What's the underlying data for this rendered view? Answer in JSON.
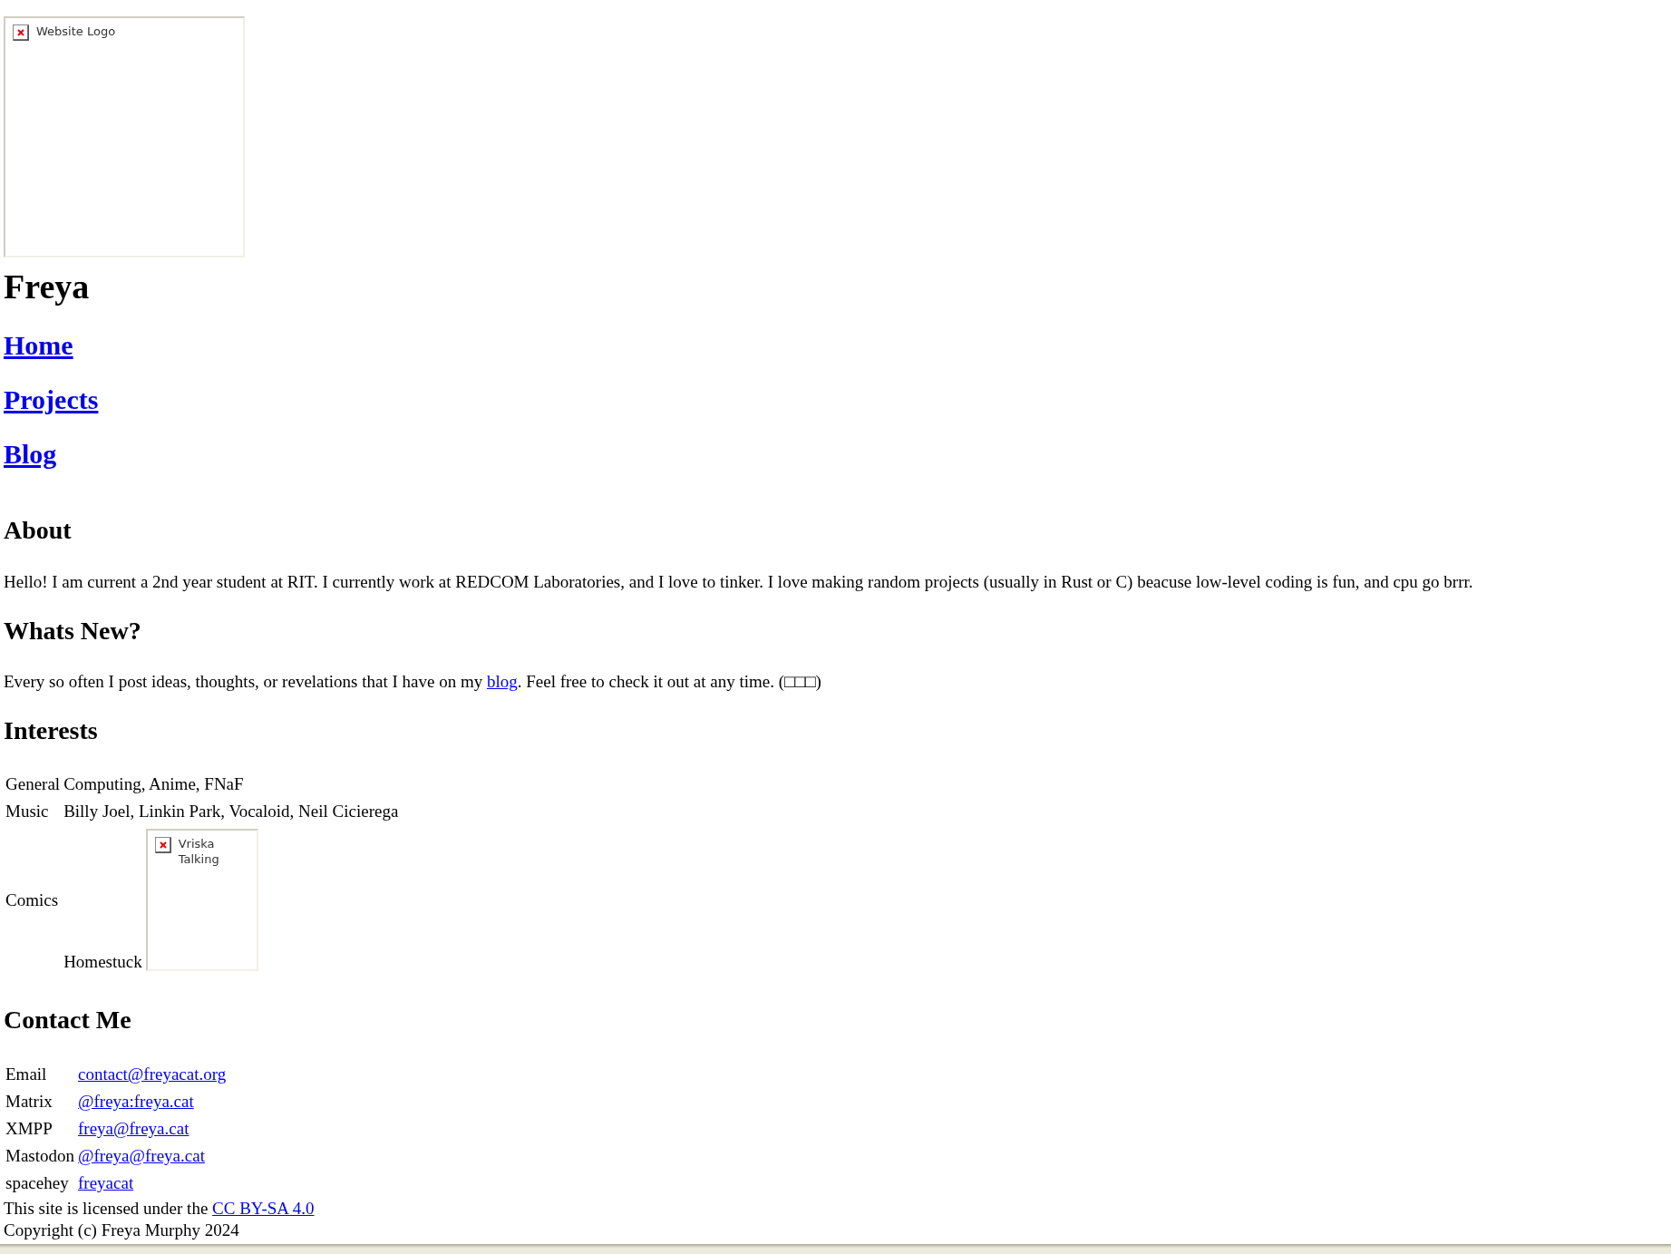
{
  "logo": {
    "alt": "Website Logo"
  },
  "title": "Freya",
  "nav": [
    {
      "label": "Home"
    },
    {
      "label": "Projects"
    },
    {
      "label": "Blog"
    }
  ],
  "about": {
    "heading": "About",
    "text": "Hello! I am current a 2nd year student at RIT. I currently work at REDCOM Laboratories, and I love to tinker. I love making random projects (usually in Rust or C) beacuse low-level coding is fun, and cpu go brrr."
  },
  "whats_new": {
    "heading": "Whats New?",
    "before": "Every so often I post ideas, thoughts, or revelations that I have on my",
    "link": "blog",
    "after": ". Feel free to check it out at any time. (□□□)"
  },
  "interests": {
    "heading": "Interests",
    "rows": [
      {
        "label": "General",
        "value": "Computing, Anime, FNaF"
      },
      {
        "label": "Music",
        "value": "Billy Joel, Linkin Park, Vocaloid, Neil Cicierega"
      },
      {
        "label": "Comics",
        "value": "Homestuck",
        "image_alt": "Vriska Talking"
      }
    ]
  },
  "contact": {
    "heading": "Contact Me",
    "rows": [
      {
        "label": "Email",
        "link": "contact@freyacat.org"
      },
      {
        "label": "Matrix",
        "link": "@freya:freya.cat"
      },
      {
        "label": "XMPP",
        "link": "freya@freya.cat"
      },
      {
        "label": "Mastodon",
        "link": "@freya@freya.cat"
      },
      {
        "label": "spacehey",
        "link": "freyacat"
      }
    ]
  },
  "license": {
    "text": "This site is licensed under the",
    "link": "CC BY-SA 4.0"
  },
  "copyright": "Copyright (c) Freya Murphy 2024"
}
